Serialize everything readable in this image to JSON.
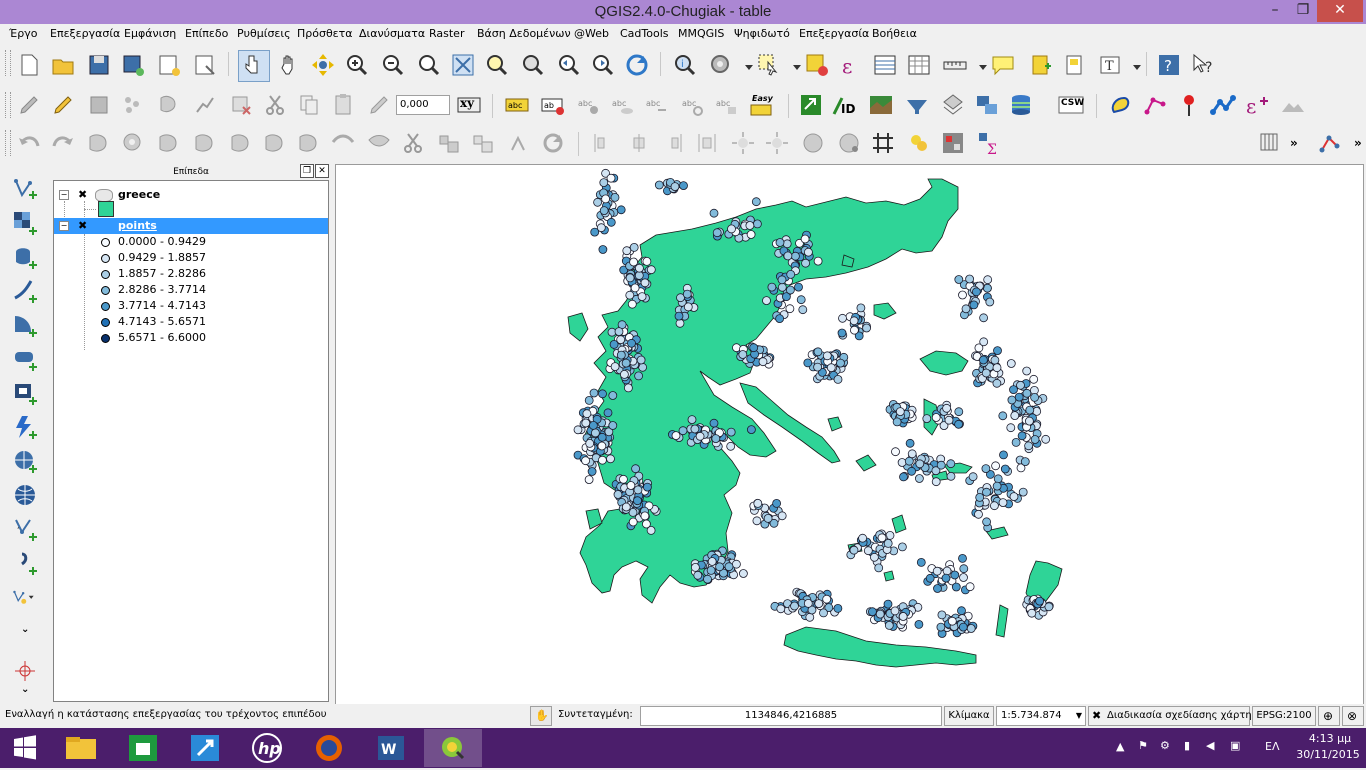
{
  "window": {
    "title": "QGIS2.4.0-Chugiak - table",
    "min": "–",
    "max": "❐",
    "close": "✕"
  },
  "menu": [
    "Έργο",
    "Επεξεργασία",
    "Εμφάνιση",
    "Επίπεδο",
    "Ρυθμίσεις",
    "Πρόσθετα",
    "Διανύσματα",
    "Raster",
    "Βάση Δεδομένων",
    "@Web",
    "CadTools",
    "MMQGIS",
    "Ψηφιδωτό",
    "Επεξεργασία",
    "Βοήθεια"
  ],
  "toolbar": {
    "width_value": "0,000",
    "xy_label": "xy",
    "csw_label": "CSW",
    "easy_label": "Easy"
  },
  "layers_panel": {
    "title": "Επίπεδα",
    "layers": [
      {
        "name": "greece",
        "color": "#2fd497"
      },
      {
        "name": "points",
        "classes": [
          {
            "label": "0.0000 - 0.9429",
            "color": "#f7fbff"
          },
          {
            "label": "0.9429 - 1.8857",
            "color": "#d6e6f4"
          },
          {
            "label": "1.8857 - 2.8286",
            "color": "#abcfe6"
          },
          {
            "label": "2.8286 - 3.7714",
            "color": "#82bbdb"
          },
          {
            "label": "3.7714 - 4.7143",
            "color": "#4a98c9"
          },
          {
            "label": "4.7143 - 5.6571",
            "color": "#2171b5"
          },
          {
            "label": "5.6571 - 6.6000",
            "color": "#08306b"
          }
        ]
      }
    ]
  },
  "status": {
    "message": "Εναλλαγή η κατάστασης επεξεργασίας του τρέχοντος επιπέδου",
    "coord_label": "Συντεταγμένη:",
    "coord_value": "1134846,4216885",
    "scale_label": "Κλίμακα",
    "scale_value": "1:5.734.874",
    "render_label": "Διαδικασία σχεδίασης χάρτη",
    "epsg": "EPSG:2100"
  },
  "taskbar": {
    "lang": "ΕΛ",
    "time": "4:13 μμ",
    "date": "30/11/2015"
  }
}
